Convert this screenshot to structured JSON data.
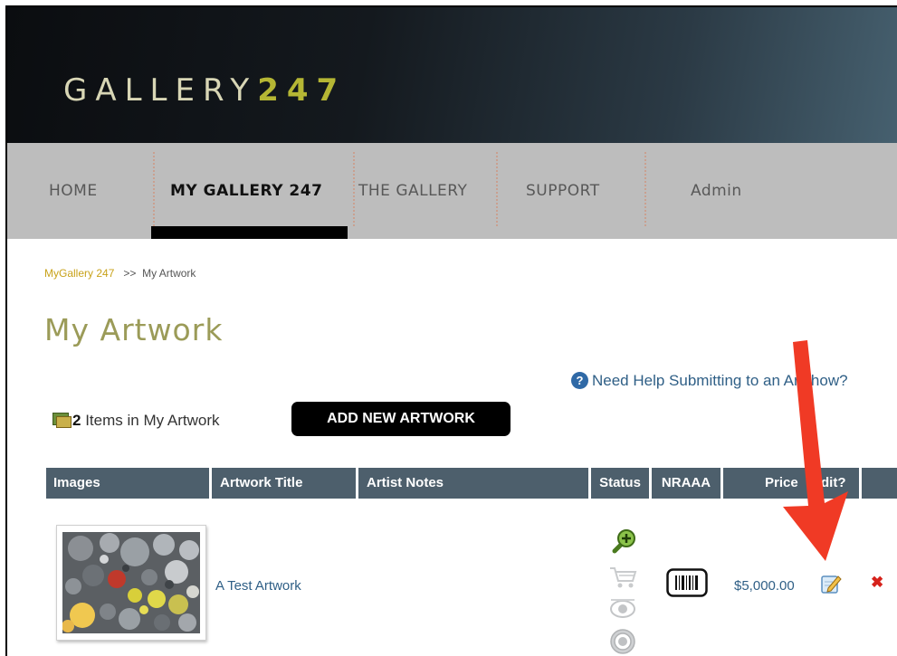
{
  "header": {
    "logo_main": "GALLERY",
    "logo_accent": "247"
  },
  "nav": {
    "items": [
      {
        "label": "HOME"
      },
      {
        "label": "MY GALLERY 247"
      },
      {
        "label": "THE GALLERY"
      },
      {
        "label": "SUPPORT"
      },
      {
        "label": "Admin"
      }
    ],
    "active": "MY GALLERY 247"
  },
  "breadcrumb": {
    "link": "MyGallery 247",
    "separator": ">>",
    "current": "My Artwork"
  },
  "page": {
    "title": "My Artwork",
    "help_text": "Need Help Submitting to an Artshow?",
    "items_count": "2",
    "items_label": "Items in My Artwork",
    "add_button": "ADD NEW ARTWORK"
  },
  "table": {
    "columns": [
      "Images",
      "Artwork Title",
      "Artist Notes",
      "Status",
      "NRAAA",
      "Price",
      "Edit?"
    ],
    "rows": [
      {
        "title": "A Test Artwork",
        "notes": "",
        "status_icons": [
          "zoom-in-icon",
          "cart-icon",
          "eye-icon",
          "target-icon"
        ],
        "nraaa_icon": "barcode-icon",
        "price": "$5,000.00",
        "edit_icon": "edit-pencil-icon",
        "delete_icon": "delete-x-icon",
        "delete_symbol": "✖"
      }
    ]
  },
  "annotation": {
    "arrow_color": "#f03a25"
  },
  "colors": {
    "nav_bg": "#bdbdbd",
    "table_header_bg": "#4d5f6c",
    "title_olive": "#9b9b58",
    "link_blue": "#2f5f86",
    "breadcrumb_gold": "#c8a21a"
  }
}
